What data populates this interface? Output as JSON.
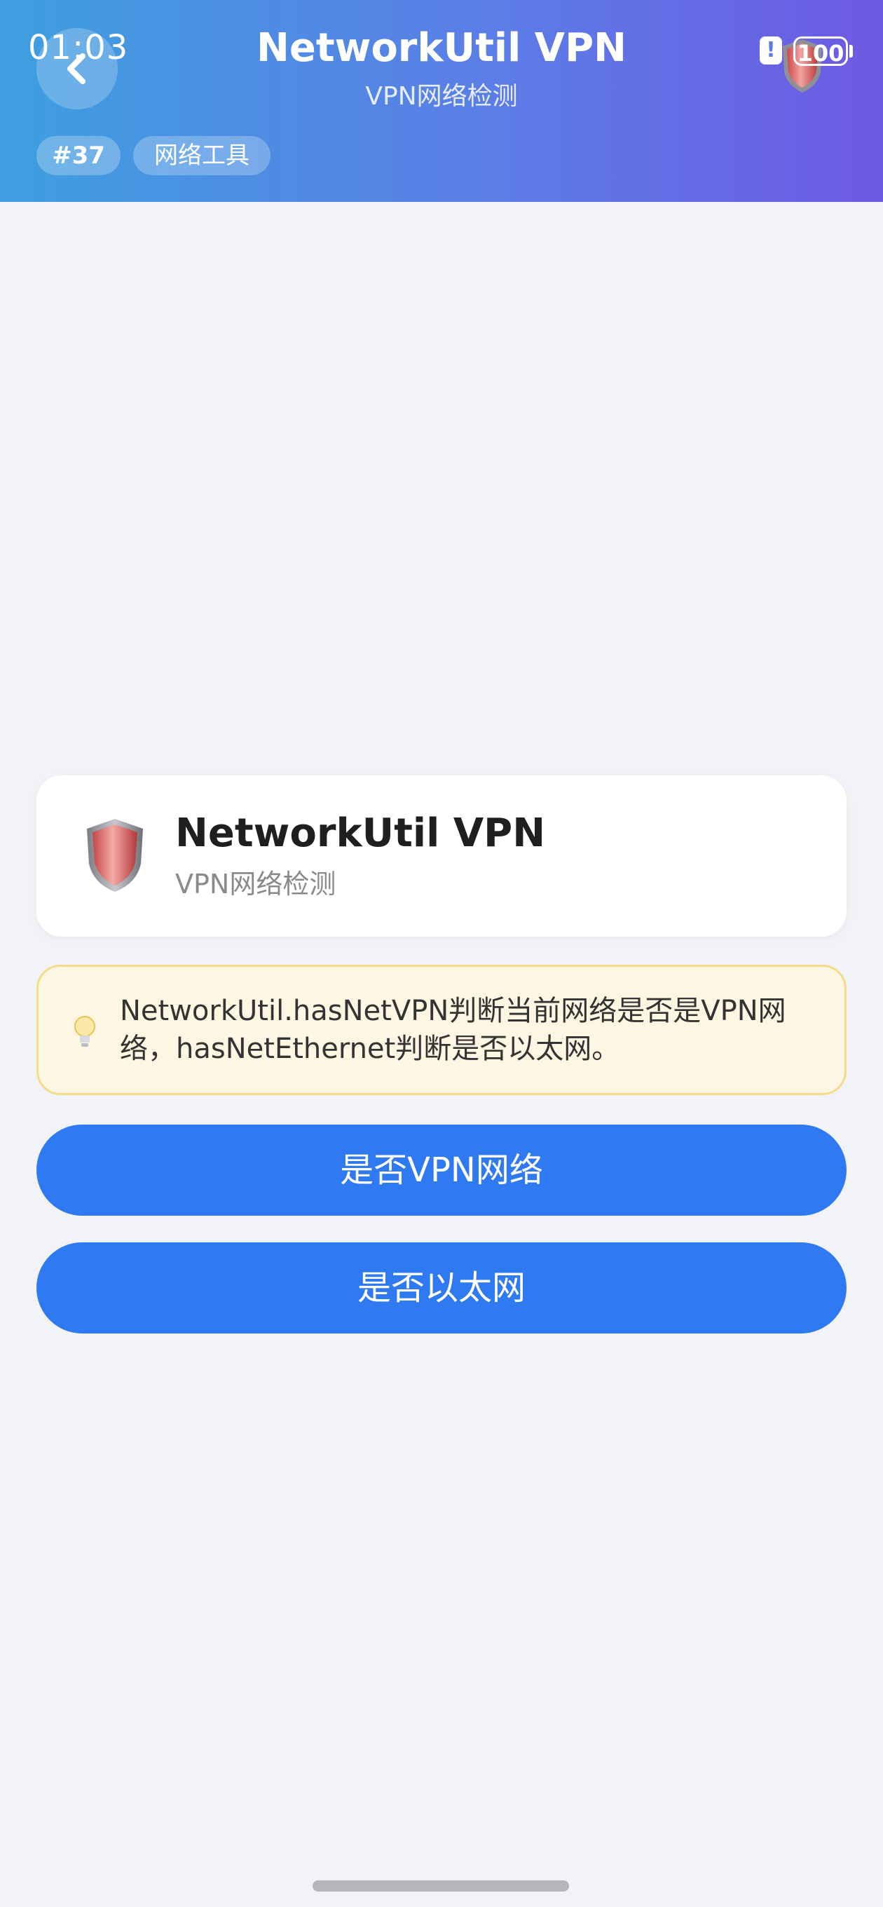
{
  "status_bar": {
    "time": "01:03",
    "battery": "100"
  },
  "header": {
    "title": "NetworkUtil VPN",
    "subtitle": "VPN网络检测",
    "tags": [
      "#37",
      "网络工具"
    ]
  },
  "card": {
    "title": "NetworkUtil VPN",
    "subtitle": "VPN网络检测",
    "icon": "shield-icon"
  },
  "tip": {
    "icon": "lightbulb-icon",
    "text": "NetworkUtil.hasNetVPN判断当前网络是否是VPN网络，hasNetEthernet判断是否以太网。"
  },
  "buttons": {
    "vpn_label": "是否VPN网络",
    "ethernet_label": "是否以太网"
  },
  "colors": {
    "header_start": "#3e9fe0",
    "header_end": "#6d5ae4",
    "primary_button": "#2f7af0",
    "tip_background": "#fdf6e2",
    "tip_border": "#f3dc8a"
  }
}
